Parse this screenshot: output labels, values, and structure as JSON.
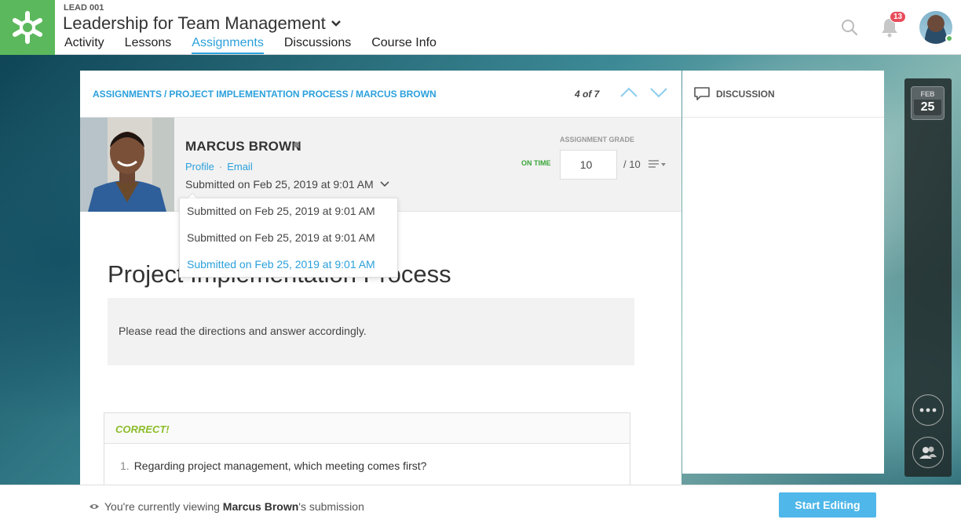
{
  "header": {
    "course_code": "LEAD 001",
    "course_title": "Leadership for Team Management",
    "tabs": [
      {
        "label": "Activity"
      },
      {
        "label": "Lessons"
      },
      {
        "label": "Assignments",
        "active": true
      },
      {
        "label": "Discussions"
      },
      {
        "label": "Course Info"
      }
    ],
    "notification_count": "13",
    "brand_color": "#5cb85c",
    "accent_color": "#2ba0dc"
  },
  "breadcrumb": {
    "root": "ASSIGNMENTS",
    "assignment": "PROJECT IMPLEMENTATION PROCESS",
    "student": "MARCUS BROWN"
  },
  "pager": {
    "text": "4 of 7"
  },
  "student": {
    "name": "MARCUS BROWN",
    "profile_link": "Profile",
    "email_link": "Email",
    "submitted": "Submitted on Feb 25, 2019 at 9:01 AM",
    "status": "ON TIME"
  },
  "grade": {
    "label": "ASSIGNMENT GRADE",
    "value": "10",
    "total": "/ 10"
  },
  "submissions_dropdown": [
    {
      "label": "Submitted on Feb 25, 2019 at 9:01 AM",
      "selected": false
    },
    {
      "label": "Submitted on Feb 25, 2019 at 9:01 AM",
      "selected": false
    },
    {
      "label": "Submitted on Feb 25, 2019 at 9:01 AM",
      "selected": true
    }
  ],
  "assignment": {
    "title": "Project Implementation Process",
    "directions": "Please read the directions and answer accordingly."
  },
  "question": {
    "result": "CORRECT!",
    "number": "1.",
    "text": "Regarding project management, which meeting comes first?"
  },
  "discussion": {
    "label": "DISCUSSION"
  },
  "calendar": {
    "month": "FEB",
    "day": "25"
  },
  "footer": {
    "prefix": "You're currently viewing ",
    "name": "Marcus Brown",
    "suffix": "'s submission",
    "button": "Start Editing"
  }
}
